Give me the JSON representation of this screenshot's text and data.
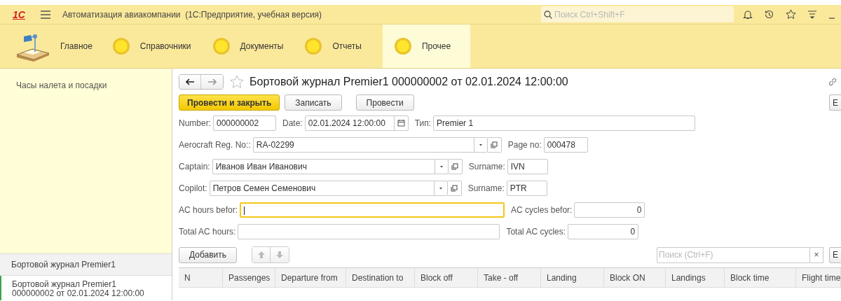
{
  "header": {
    "logo": "1С",
    "title": "Автоматизация авиакомпании  (1С:Предприятие, учебная версия)",
    "search": {
      "placeholder": "Поиск Ctrl+Shift+F"
    }
  },
  "sections": [
    {
      "label": "Главное",
      "kind": "home",
      "selected": false
    },
    {
      "label": "Справочники",
      "kind": "circle",
      "selected": false
    },
    {
      "label": "Документы",
      "kind": "circle",
      "selected": false
    },
    {
      "label": "Отчеты",
      "kind": "circle",
      "selected": false
    },
    {
      "label": "Прочее",
      "kind": "circle",
      "selected": true
    }
  ],
  "sidebar": {
    "items": [
      {
        "label": "Часы налета и посадки"
      }
    ]
  },
  "open_windows": {
    "title": "Бортовой журнал Premier1",
    "items": [
      {
        "title": "Бортовой журнал Premier1",
        "subtitle": "000000002 от 02.01.2024 12:00:00",
        "selected": true
      }
    ]
  },
  "form": {
    "title": "Бортовой журнал Premier1 000000002 от 02.01.2024 12:00:00",
    "buttons": [
      {
        "label": "Провести и закрыть",
        "kind": "primary"
      },
      {
        "label": "Записать",
        "kind": "normal"
      },
      {
        "label": "Провести",
        "kind": "normal"
      }
    ],
    "more_button": "Е",
    "rows": [
      [
        {
          "label": "Number:",
          "value": "000000002",
          "kind": "text"
        },
        {
          "label": "Date:",
          "value": "02.01.2024 12:00:00",
          "kind": "date"
        },
        {
          "label": "Тип:",
          "value": "Premier 1",
          "kind": "text"
        }
      ],
      [
        {
          "label": "Aerocraft Reg. No::",
          "value": "RA-02299",
          "kind": "select"
        },
        {
          "label": "Page no:",
          "value": "000478",
          "kind": "text"
        }
      ],
      [
        {
          "label": "Captain:",
          "value": "Иванов Иван Иванович",
          "kind": "select"
        },
        {
          "label": "Surname:",
          "value": "IVN",
          "kind": "text"
        }
      ],
      [
        {
          "label": "Copilot:",
          "value": "Петров Семен Семенович",
          "kind": "select"
        },
        {
          "label": "Surname:",
          "value": "PTR",
          "kind": "text"
        }
      ],
      [
        {
          "label": "AC hours befor:",
          "kind": "text",
          "focused": true
        },
        {
          "label": "AC cycles befor:",
          "value": "0",
          "kind": "number"
        }
      ],
      [
        {
          "label": "Total AC hours:",
          "kind": "text",
          "focused": false
        },
        {
          "label": "Total AC cycles:",
          "value": "0",
          "kind": "number"
        }
      ]
    ]
  },
  "table": {
    "add_button": "Добавить",
    "move_disabled": true,
    "search": {
      "placeholder": "Поиск (Ctrl+F)"
    },
    "clear": "×",
    "more_button": "Е",
    "columns": [
      {
        "label": "N"
      },
      {
        "label": "Passenges"
      },
      {
        "label": "Departure from"
      },
      {
        "label": "Destination to"
      },
      {
        "label": "Block off"
      },
      {
        "label": "Take - off"
      },
      {
        "label": "Landing"
      },
      {
        "label": "Block ON"
      },
      {
        "label": "Landings"
      },
      {
        "label": "Block time"
      },
      {
        "label": "Flight time"
      }
    ]
  }
}
